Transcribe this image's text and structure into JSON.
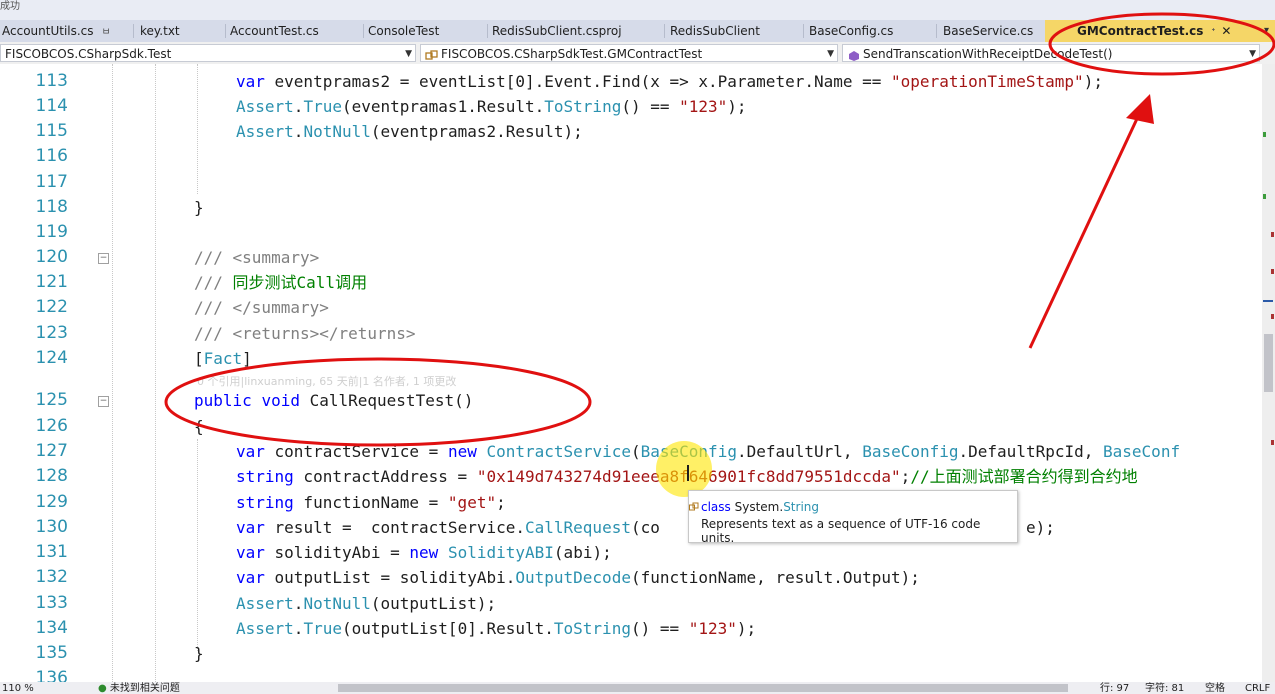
{
  "app": {
    "top_hint": "成功"
  },
  "tabs": [
    {
      "label": "AccountUtils.cs",
      "pin": "ㅂ"
    },
    {
      "label": "key.txt"
    },
    {
      "label": "AccountTest.cs"
    },
    {
      "label": "ConsoleTest"
    },
    {
      "label": "RedisSubClient.csproj"
    },
    {
      "label": "RedisSubClient"
    },
    {
      "label": "BaseConfig.cs"
    },
    {
      "label": "BaseService.cs"
    },
    {
      "label": "GMContractTest.cs",
      "pin": "ᐩ",
      "close": "✕",
      "active": true
    }
  ],
  "tab_overflow": "▾",
  "nav": {
    "project": "FISCOBCOS.CSharpSdk.Test",
    "class": "FISCOBCOS.CSharpSdkTest.GMContractTest",
    "member": "SendTranscationWithReceiptDecodeTest()"
  },
  "code_lens": "0 个引用|linxuanming, 65 天前|1 名作者, 1 项更改",
  "lines": [
    {
      "n": "113"
    },
    {
      "n": "114"
    },
    {
      "n": "115"
    },
    {
      "n": "116"
    },
    {
      "n": "117"
    },
    {
      "n": "118"
    },
    {
      "n": "119"
    },
    {
      "n": "120"
    },
    {
      "n": "121"
    },
    {
      "n": "122"
    },
    {
      "n": "123"
    },
    {
      "n": "124"
    },
    {
      "n": "125"
    },
    {
      "n": "126"
    },
    {
      "n": "127"
    },
    {
      "n": "128"
    },
    {
      "n": "129"
    },
    {
      "n": "130"
    },
    {
      "n": "131"
    },
    {
      "n": "132"
    },
    {
      "n": "133"
    },
    {
      "n": "134"
    },
    {
      "n": "135"
    },
    {
      "n": "136"
    }
  ],
  "code": {
    "l113": [
      "var ",
      "eventpramas2 = eventList[0].Event.",
      "Find",
      "(x => x.Parameter.Name == ",
      "\"operationTimeStamp\"",
      ");"
    ],
    "l114": [
      "Assert",
      ".",
      "True",
      "(eventpramas1.Result.",
      "ToString",
      "() == ",
      "\"123\"",
      ");"
    ],
    "l115": [
      "Assert",
      ".",
      "NotNull",
      "(eventpramas2.Result);"
    ],
    "l118": "}",
    "l120": [
      "/// ",
      "<summary>"
    ],
    "l121": [
      "/// ",
      "同步测试Call调用"
    ],
    "l122": [
      "/// ",
      "</summary>"
    ],
    "l123": [
      "/// ",
      "<returns></returns>"
    ],
    "l124": [
      "[",
      "Fact",
      "]"
    ],
    "l125": [
      "public",
      " ",
      "void",
      " CallRequestTest()"
    ],
    "l126": "{",
    "l127": [
      "var",
      " contractService = ",
      "new",
      " ",
      "ContractService",
      "(",
      "BaseConfig",
      ".DefaultUrl, ",
      "BaseConfig",
      ".DefaultRpcId, ",
      "BaseConf"
    ],
    "l128": [
      "string",
      " contractAddress = ",
      "\"0x149d743274d91eeea8f646901fc8dd79551dccda\"",
      ";",
      "//上面测试部署合约得到合约地"
    ],
    "l129": [
      "string",
      " functionName = ",
      "\"get\"",
      ";"
    ],
    "l130": [
      "var",
      " result =  contractService.",
      "CallRequest",
      "(co",
      "e);"
    ],
    "l131": [
      "var",
      " solidityAbi = ",
      "new",
      " ",
      "SolidityABI",
      "(abi);"
    ],
    "l132": [
      "var",
      " outputList = solidityAbi.",
      "OutputDecode",
      "(functionName, result.Output);"
    ],
    "l133": [
      "Assert",
      ".",
      "NotNull",
      "(outputList);"
    ],
    "l134": [
      "Assert",
      ".",
      "True",
      "(outputList[0].Result.",
      "ToString",
      "() == ",
      "\"123\"",
      ");"
    ],
    "l135": "}"
  },
  "tooltip": {
    "kind": "class",
    "type_ns": "System.",
    "type_name": "String",
    "description": "Represents text as a sequence of UTF-16 code units."
  },
  "status": {
    "zoom": "110 %",
    "issues": "未找到相关问题",
    "line": "行: 97",
    "char": "字符: 81",
    "spaces": "空格",
    "eol": "CRLF"
  }
}
